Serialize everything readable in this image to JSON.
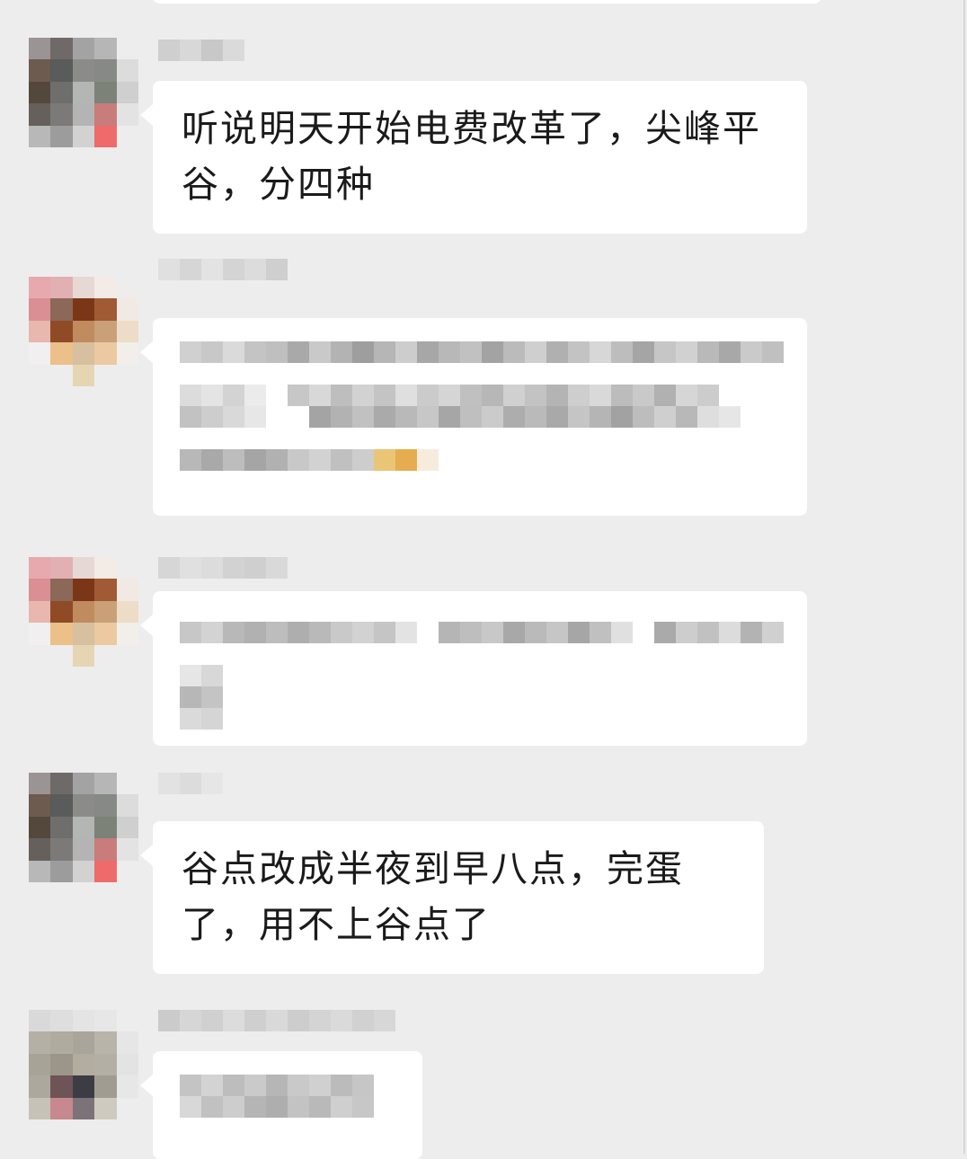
{
  "messages": [
    {
      "sender": "",
      "text": "听说明天开始电费改革了，尖峰平谷，分四种"
    },
    {
      "sender": "",
      "text": ""
    },
    {
      "sender": "",
      "text": ""
    },
    {
      "sender": "",
      "text": "谷点改成半夜到早八点，完蛋了，用不上谷点了"
    },
    {
      "sender": "",
      "text": ""
    }
  ],
  "colors": {
    "background": "#ededed",
    "bubble": "#ffffff",
    "text": "#1a1a1a"
  }
}
